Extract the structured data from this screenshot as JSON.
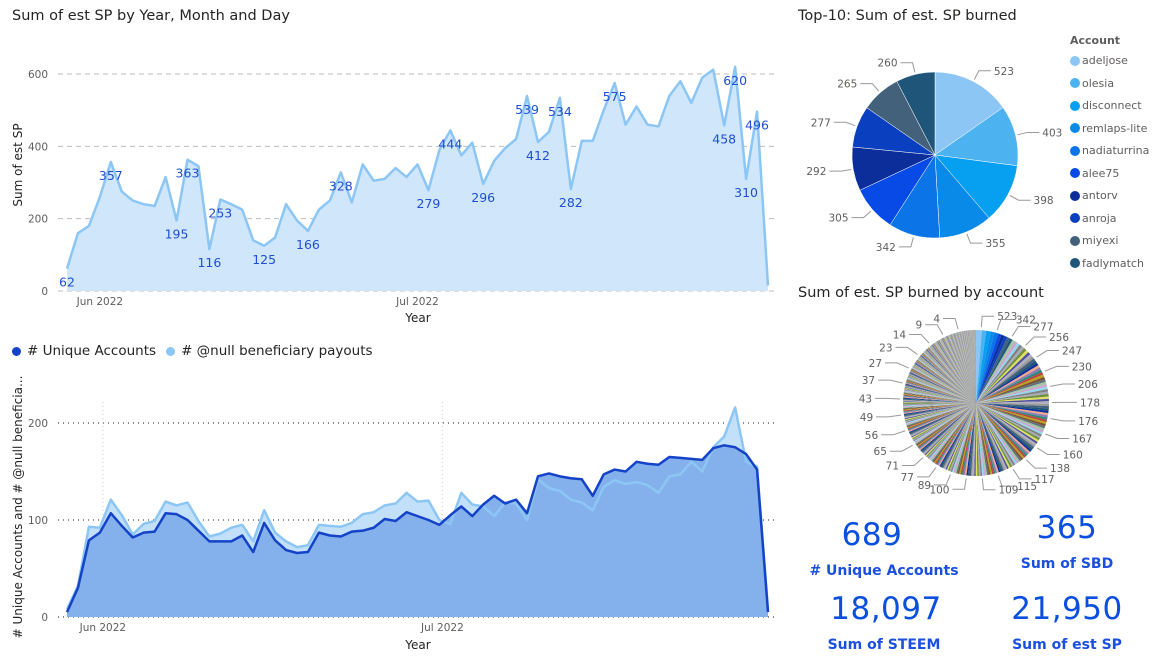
{
  "top_chart_title": "Sum of est SP by Year, Month and Day",
  "bottom_legend": {
    "series1": "# Unique Accounts",
    "series2": "# @null beneficiary payouts",
    "color1": "#1443c8",
    "color2": "#8cc6f5"
  },
  "top10_title": "Top-10: Sum of est. SP burned",
  "top10_legend_title": "Account",
  "all_pie_title": "Sum of est. SP burned by account",
  "kpis": [
    {
      "value": "689",
      "label": "# Unique Accounts"
    },
    {
      "value": "365",
      "label": "Sum of SBD"
    },
    {
      "value": "18,097",
      "label": "Sum of STEEM"
    },
    {
      "value": "21,950",
      "label": "Sum of est SP"
    }
  ],
  "chart_data": [
    {
      "type": "area",
      "title": "Sum of est SP by Year, Month and Day",
      "xlabel": "Year",
      "ylabel": "Sum of est SP",
      "ylim": [
        0,
        600
      ],
      "yticks": [
        0,
        200,
        400,
        600
      ],
      "xticks": [
        {
          "index": 3,
          "label": "Jun 2022"
        },
        {
          "index": 32,
          "label": "Jul 2022"
        }
      ],
      "grid": true,
      "color": "#8cc6f5",
      "values": [
        62,
        160,
        180,
        260,
        357,
        275,
        250,
        240,
        235,
        315,
        195,
        363,
        345,
        116,
        253,
        240,
        225,
        140,
        125,
        148,
        240,
        195,
        166,
        225,
        250,
        328,
        245,
        350,
        305,
        310,
        340,
        315,
        350,
        279,
        390,
        444,
        375,
        410,
        296,
        360,
        395,
        420,
        539,
        412,
        440,
        534,
        282,
        415,
        415,
        500,
        575,
        460,
        510,
        460,
        455,
        540,
        580,
        520,
        590,
        612,
        458,
        620,
        310,
        496,
        15
      ],
      "labeled_points": [
        {
          "index": 0,
          "value": 62,
          "pos": "below"
        },
        {
          "index": 4,
          "value": 357,
          "pos": "below"
        },
        {
          "index": 10,
          "value": 195,
          "pos": "below"
        },
        {
          "index": 11,
          "value": 363,
          "pos": "below"
        },
        {
          "index": 13,
          "value": 116,
          "pos": "below"
        },
        {
          "index": 14,
          "value": 253,
          "pos": "below"
        },
        {
          "index": 18,
          "value": 125,
          "pos": "below"
        },
        {
          "index": 22,
          "value": 166,
          "pos": "below"
        },
        {
          "index": 25,
          "value": 328,
          "pos": "below"
        },
        {
          "index": 33,
          "value": 279,
          "pos": "below"
        },
        {
          "index": 35,
          "value": 444,
          "pos": "below"
        },
        {
          "index": 38,
          "value": 296,
          "pos": "below"
        },
        {
          "index": 42,
          "value": 539,
          "pos": "below"
        },
        {
          "index": 43,
          "value": 412,
          "pos": "below"
        },
        {
          "index": 45,
          "value": 534,
          "pos": "below"
        },
        {
          "index": 46,
          "value": 282,
          "pos": "below"
        },
        {
          "index": 50,
          "value": 575,
          "pos": "below"
        },
        {
          "index": 60,
          "value": 458,
          "pos": "below"
        },
        {
          "index": 61,
          "value": 620,
          "pos": "below"
        },
        {
          "index": 62,
          "value": 310,
          "pos": "below"
        },
        {
          "index": 63,
          "value": 496,
          "pos": "below"
        }
      ]
    },
    {
      "type": "area",
      "title": "",
      "xlabel": "Year",
      "ylabel": "# Unique Accounts and # @null beneficia...",
      "ylim": [
        0,
        250
      ],
      "yticks": [
        0,
        100,
        200
      ],
      "xticks": [
        {
          "index": 3,
          "label": "Jun 2022"
        },
        {
          "index": 34,
          "label": "Jul 2022"
        }
      ],
      "legend": "top-left",
      "series": [
        {
          "name": "# @null beneficiary payouts",
          "color": "#8cc6f5",
          "values": [
            8,
            32,
            93,
            92,
            121,
            105,
            85,
            96,
            99,
            119,
            115,
            118,
            99,
            83,
            86,
            92,
            95,
            78,
            110,
            87,
            78,
            72,
            74,
            95,
            94,
            93,
            97,
            106,
            108,
            115,
            117,
            128,
            119,
            120,
            100,
            96,
            128,
            116,
            114,
            104,
            118,
            117,
            100,
            142,
            133,
            130,
            121,
            118,
            110,
            134,
            141,
            137,
            139,
            136,
            128,
            145,
            147,
            160,
            150,
            175,
            186,
            216,
            160,
            155,
            8
          ]
        },
        {
          "name": "# Unique Accounts",
          "color": "#1443c8",
          "values": [
            5,
            30,
            79,
            87,
            107,
            94,
            82,
            87,
            88,
            107,
            106,
            100,
            89,
            78,
            78,
            78,
            84,
            67,
            97,
            79,
            69,
            66,
            67,
            87,
            84,
            83,
            88,
            89,
            92,
            101,
            99,
            108,
            104,
            100,
            95,
            105,
            114,
            104,
            116,
            125,
            117,
            121,
            107,
            145,
            148,
            145,
            143,
            142,
            125,
            147,
            152,
            150,
            160,
            158,
            157,
            165,
            164,
            163,
            162,
            174,
            177,
            175,
            168,
            152,
            5
          ]
        }
      ]
    },
    {
      "type": "pie",
      "title": "Top-10: Sum of est. SP burned",
      "legend_title": "Account",
      "legend": "right",
      "slices": [
        {
          "label": "adeljose",
          "value": 523,
          "color": "#8cc6f5"
        },
        {
          "label": "olesia",
          "value": 403,
          "color": "#4db3f0"
        },
        {
          "label": "disconnect",
          "value": 398,
          "color": "#079ff0"
        },
        {
          "label": "remlaps-lite",
          "value": 355,
          "color": "#0a8ae8"
        },
        {
          "label": "nadiaturrina",
          "value": 342,
          "color": "#0b74e6"
        },
        {
          "label": "alee75",
          "value": 305,
          "color": "#074ae6"
        },
        {
          "label": "antorv",
          "value": 292,
          "color": "#0c2e9a"
        },
        {
          "label": "anroja",
          "value": 277,
          "color": "#0a3fc0"
        },
        {
          "label": "miyexi",
          "value": 265,
          "color": "#44617c"
        },
        {
          "label": "fadlymatch",
          "value": 260,
          "color": "#1f5578"
        }
      ]
    },
    {
      "type": "pie",
      "title": "Sum of est. SP burned by account",
      "total_accounts": 689,
      "visible_labels": [
        523,
        342,
        277,
        256,
        247,
        230,
        206,
        178,
        176,
        167,
        160,
        138,
        117,
        115,
        109,
        100,
        89,
        77,
        71,
        65,
        56,
        49,
        43,
        37,
        27,
        23,
        14,
        9,
        4
      ]
    }
  ]
}
